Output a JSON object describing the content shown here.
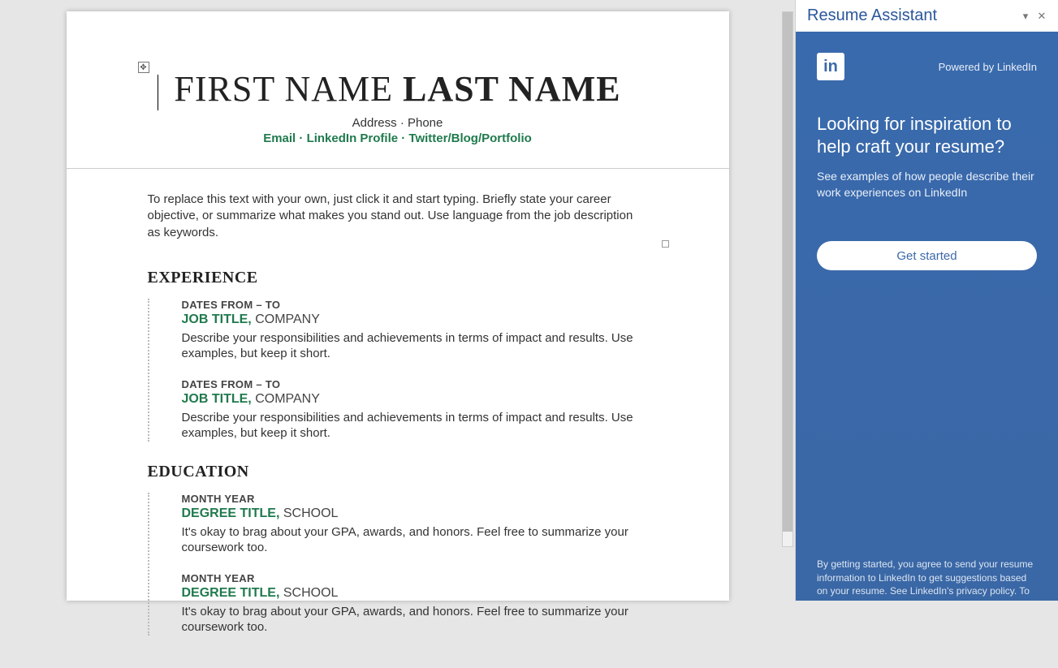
{
  "resume": {
    "first_name": "FIRST NAME",
    "last_name": "LAST NAME",
    "address_line": "Address · Phone",
    "links_email": "Email",
    "links_linkedin": "LinkedIn Profile",
    "links_social": "Twitter/Blog/Portfolio",
    "dot": " · ",
    "intro": "To replace this text with your own, just click it and start typing. Briefly state your career objective, or summarize what makes you stand out. Use language from the job description as keywords.",
    "sections": {
      "experience": {
        "heading": "EXPERIENCE",
        "items": [
          {
            "date": "DATES FROM – TO",
            "title": "JOB TITLE,",
            "org": "COMPANY",
            "desc": "Describe your responsibilities and achievements in terms of impact and results. Use examples, but keep it short."
          },
          {
            "date": "DATES FROM – TO",
            "title": "JOB TITLE,",
            "org": "COMPANY",
            "desc": "Describe your responsibilities and achievements in terms of impact and results. Use examples, but keep it short."
          }
        ]
      },
      "education": {
        "heading": "EDUCATION",
        "items": [
          {
            "date": "MONTH YEAR",
            "title": "DEGREE TITLE,",
            "org": "SCHOOL",
            "desc": "It's okay to brag about your GPA, awards, and honors. Feel free to summarize your coursework too."
          },
          {
            "date": "MONTH YEAR",
            "title": "DEGREE TITLE,",
            "org": "SCHOOL",
            "desc": "It's okay to brag about your GPA, awards, and honors. Feel free to summarize your coursework too."
          }
        ]
      }
    }
  },
  "panel": {
    "title": "Resume Assistant",
    "logo_text": "in",
    "powered": "Powered by LinkedIn",
    "heading": "Looking for inspiration to help craft your resume?",
    "sub": "See examples of how people describe their work experiences on LinkedIn",
    "cta": "Get started",
    "disclaimer": "By getting started, you agree to send your resume information to LinkedIn to get suggestions based on your resume. See LinkedIn's privacy policy. To"
  }
}
